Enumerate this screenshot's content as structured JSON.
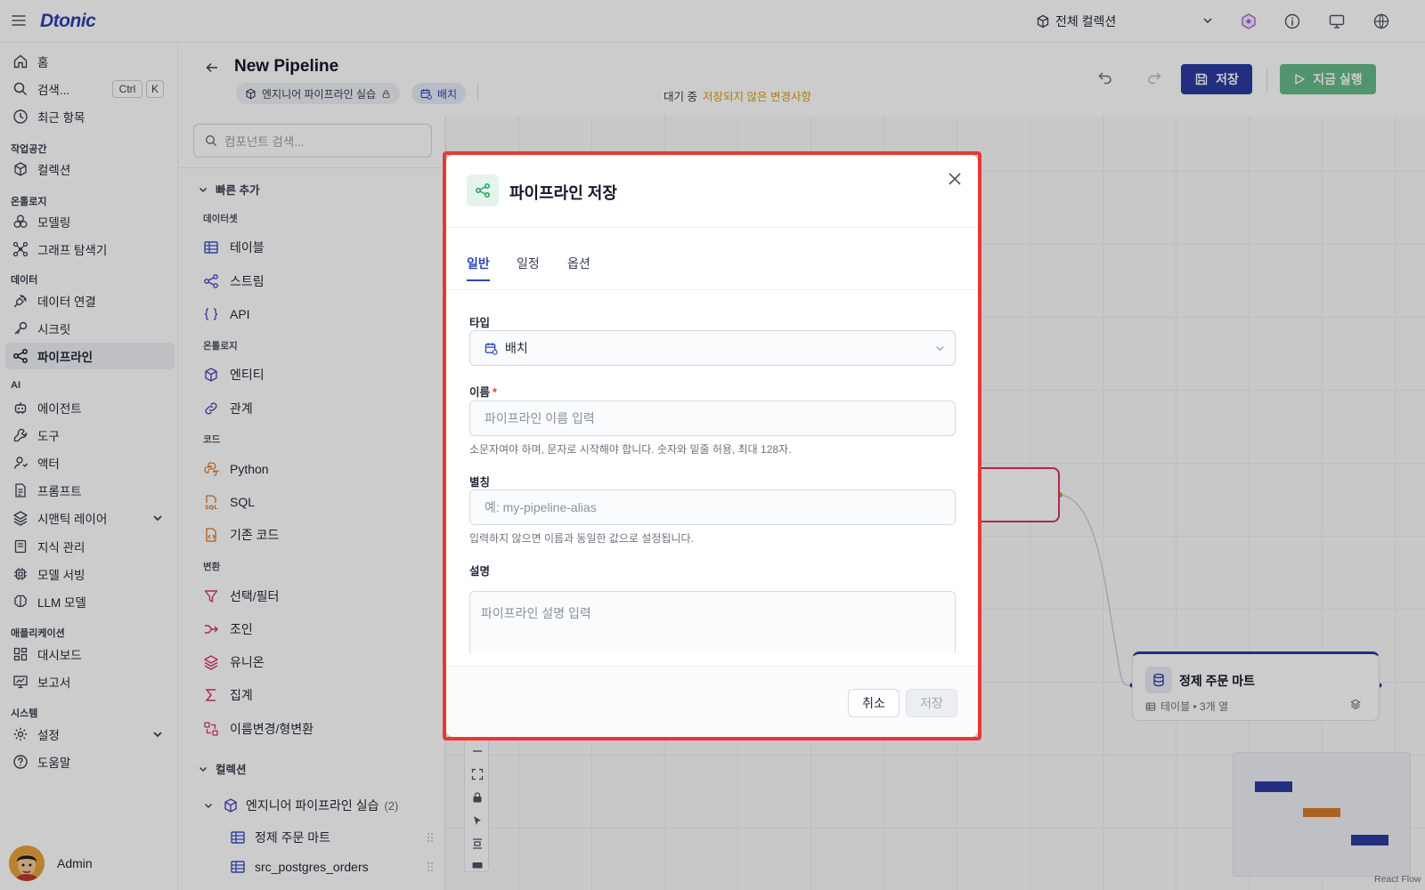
{
  "app": {
    "logo": "Dtonic",
    "collection": "전체 컬렉션"
  },
  "sidebar": {
    "home": "홈",
    "search": "검색...",
    "kbd_ctrl": "Ctrl",
    "kbd_k": "K",
    "recent": "최근 항목",
    "sections": {
      "workspace": "작업공간",
      "ontology": "온톨로지",
      "data": "데이터",
      "ai": "AI",
      "apps": "애플리케이션",
      "system": "시스템"
    },
    "items": {
      "collection": "컬렉션",
      "modeling": "모델링",
      "graph": "그래프 탐색기",
      "data_conn": "데이터 연결",
      "secret": "시크릿",
      "pipeline": "파이프라인",
      "agent": "에이전트",
      "tool": "도구",
      "actor": "액터",
      "prompt": "프롬프트",
      "semantic": "시맨틱 레이어",
      "knowledge": "지식 관리",
      "serving": "모델 서빙",
      "llm": "LLM 모델",
      "dashboard": "대시보드",
      "report": "보고서",
      "settings": "설정",
      "help": "도움말"
    },
    "user": "Admin"
  },
  "header": {
    "title": "New Pipeline",
    "chip_collection": "엔지니어 파이프라인 실습",
    "chip_type": "배치",
    "status": "대기 중",
    "unsaved": "저장되지 않은 변경사항",
    "save": "저장",
    "run": "지금 실행"
  },
  "panel": {
    "search_placeholder": "컴포넌트 검색...",
    "quick_add": "빠른 추가",
    "groups": {
      "dataset": "데이터셋",
      "ontology": "온톨로지",
      "code": "코드",
      "transform": "변환"
    },
    "components": {
      "table": "테이블",
      "stream": "스트림",
      "api": "API",
      "entity": "엔티티",
      "relation": "관계",
      "python": "Python",
      "sql": "SQL",
      "existing_code": "기존 코드",
      "filter": "선택/필터",
      "join": "조인",
      "union": "유니온",
      "aggregate": "집계",
      "rename": "이름변경/형변환"
    },
    "collection_group": "컬렉션",
    "tree": {
      "collection": "엔지니어 파이프라인 실습",
      "count": "(2)",
      "item1": "정제 주문 마트",
      "item2": "src_postgres_orders"
    }
  },
  "canvas": {
    "node_title": "정제 주문 마트",
    "node_meta": "테이블 • 3개 열",
    "footer": "React Flow"
  },
  "modal": {
    "title": "파이프라인 저장",
    "tabs": [
      "일반",
      "일정",
      "옵션"
    ],
    "type_label": "타입",
    "type_value": "배치",
    "name_label": "이름",
    "name_required": "*",
    "name_placeholder": "파이프라인 이름 입력",
    "name_hint": "소문자여야 하며, 문자로 시작해야 합니다. 숫자와 밑줄 허용, 최대 128자.",
    "alias_label": "별칭",
    "alias_placeholder": "예: my-pipeline-alias",
    "alias_hint": "입력하지 않으면 이름과 동일한 값으로 설정됩니다.",
    "desc_label": "설명",
    "desc_placeholder": "파이프라인 설명 입력",
    "cancel": "취소",
    "save": "저장"
  },
  "colors": {
    "primary": "#2b3a9f",
    "run_green": "#66b98a",
    "warning": "#d99a1a",
    "highlight": "#e53935",
    "node_pink": "#d6336c",
    "minimap_orange": "#d97a2b"
  }
}
